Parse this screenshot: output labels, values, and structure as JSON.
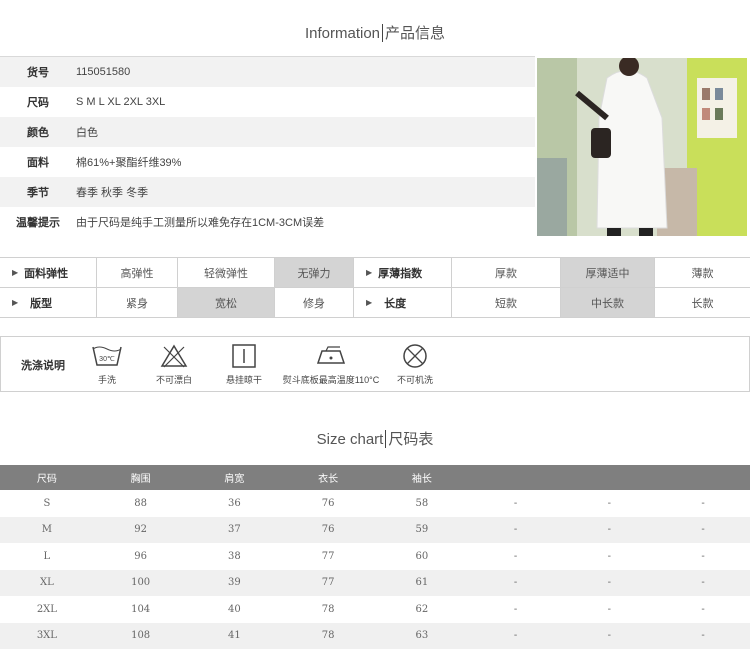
{
  "info_title": {
    "en": "Information",
    "zh": "产品信息"
  },
  "product_info": [
    {
      "key": "货号",
      "value": "115051580"
    },
    {
      "key": "尺码",
      "value": "S M L XL 2XL 3XL"
    },
    {
      "key": "颜色",
      "value": "白色"
    },
    {
      "key": "面料",
      "value": "棉61%+聚酯纤维39%"
    },
    {
      "key": "季节",
      "value": "春季 秋季 冬季"
    },
    {
      "key": "温馨提示",
      "value": "由于尺码是纯手工测量所以难免存在1CM-3CM误差"
    }
  ],
  "attributes": {
    "row1": {
      "label1": "面料弹性",
      "opts1": [
        "高弹性",
        "轻微弹性",
        "无弹力"
      ],
      "selected1": 2,
      "label2": "厚薄指数",
      "opts2": [
        "厚款",
        "厚薄适中",
        "薄款"
      ],
      "selected2": 1
    },
    "row2": {
      "label1": "版型",
      "opts1": [
        "紧身",
        "宽松",
        "修身"
      ],
      "selected1": 1,
      "label2": "长度",
      "opts2": [
        "短款",
        "中长款",
        "长款"
      ],
      "selected2": 1
    }
  },
  "washing": {
    "title": "洗涤说明",
    "temp": "30℃",
    "items": [
      {
        "icon": "hand-wash-icon",
        "label": "手洗"
      },
      {
        "icon": "no-bleach-icon",
        "label": "不可漂白"
      },
      {
        "icon": "hang-dry-icon",
        "label": "悬挂晾干"
      },
      {
        "icon": "iron-icon",
        "label": "熨斗底板最高温度110°C"
      },
      {
        "icon": "no-machine-wash-icon",
        "label": "不可机洗"
      }
    ]
  },
  "size_title": {
    "en": "Size chart",
    "zh": "尺码表"
  },
  "size_chart": {
    "headers": [
      "尺码",
      "胸围",
      "肩宽",
      "衣长",
      "袖长",
      "",
      "",
      ""
    ],
    "rows": [
      [
        "S",
        "88",
        "36",
        "76",
        "58",
        "-",
        "-",
        "-"
      ],
      [
        "M",
        "92",
        "37",
        "76",
        "59",
        "-",
        "-",
        "-"
      ],
      [
        "L",
        "96",
        "38",
        "77",
        "60",
        "-",
        "-",
        "-"
      ],
      [
        "XL",
        "100",
        "39",
        "77",
        "61",
        "-",
        "-",
        "-"
      ],
      [
        "2XL",
        "104",
        "40",
        "78",
        "62",
        "-",
        "-",
        "-"
      ],
      [
        "3XL",
        "108",
        "41",
        "78",
        "63",
        "-",
        "-",
        "-"
      ]
    ]
  }
}
